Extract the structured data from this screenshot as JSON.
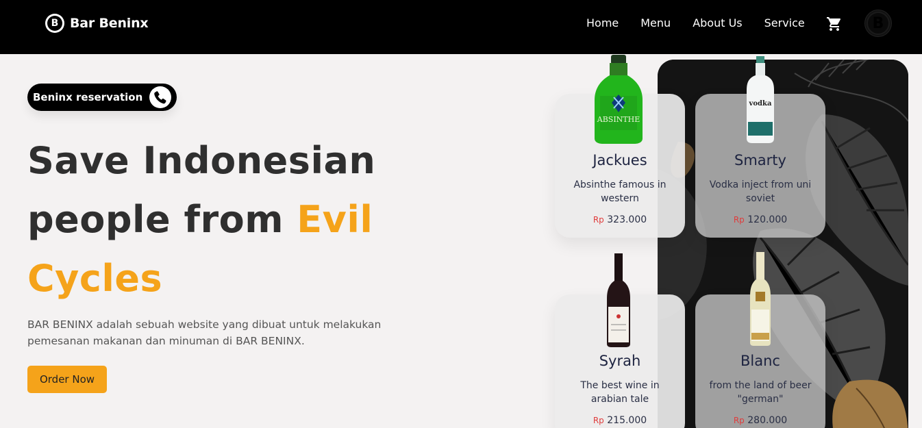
{
  "brand": {
    "name": "Bar Beninx",
    "logo_letter": "B"
  },
  "nav": {
    "links": [
      "Home",
      "Menu",
      "About Us",
      "Service"
    ],
    "cart_icon": "cart-icon",
    "avatar_letter": "B"
  },
  "hero": {
    "reservation_label": "Beninx reservation",
    "title_line1": "Save Indonesian",
    "title_line2_plain": "people from ",
    "title_line2_accent": "Evil",
    "title_line3_accent": "Cycles",
    "description": "BAR BENINX adalah sebuah website yang dibuat untuk melakukan pemesanan makanan dan minuman di BAR BENINX.",
    "order_button": "Order Now"
  },
  "products": [
    {
      "name": "Jackues",
      "description": "Absinthe famous in western",
      "currency": "Rp",
      "price": "323.000"
    },
    {
      "name": "Smarty",
      "description": "Vodka inject from uni soviet",
      "currency": "Rp",
      "price": "120.000"
    },
    {
      "name": "Syrah",
      "description": "The best wine in arabian tale",
      "currency": "Rp",
      "price": "215.000"
    },
    {
      "name": "Blanc",
      "description": "from the land of beer \"german\"",
      "currency": "Rp",
      "price": "280.000"
    }
  ],
  "colors": {
    "accent": "#f5a31a",
    "nav_bg": "#000000",
    "price_currency": "#e03b3b"
  }
}
